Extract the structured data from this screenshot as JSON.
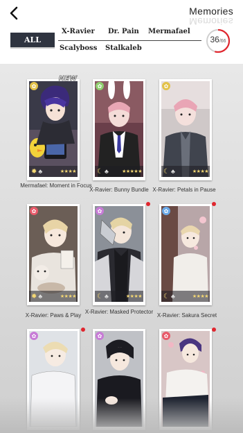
{
  "header": {
    "title": "Memories",
    "all_tab": "ALL",
    "filters": [
      "X-Ravier",
      "Dr. Pain",
      "Mermafael",
      "Scalyboss",
      "Stalkaleb"
    ],
    "count_current": "36",
    "count_total": "/66"
  },
  "cards": [
    {
      "caption": "Mermafael: Moment in Focus",
      "badge_color": "#e3c24a",
      "stars": "★★★★",
      "is_new": true,
      "new_label": "NEW",
      "has_dot": false
    },
    {
      "caption": "X-Ravier: Bunny Bundle",
      "badge_color": "#8fcf6f",
      "stars": "★★★★★",
      "is_new": false,
      "has_dot": false
    },
    {
      "caption": "X-Ravier: Petals in Pause",
      "badge_color": "#e3c24a",
      "stars": "★★★★",
      "is_new": false,
      "has_dot": false
    },
    {
      "caption": "X-Ravier: Paws & Play",
      "badge_color": "#e85a6a",
      "stars": "★★★★",
      "is_new": false,
      "has_dot": false
    },
    {
      "caption": "X-Ravier: Masked Protector",
      "badge_color": "#c77bd6",
      "stars": "★★★★",
      "is_new": false,
      "has_dot": true
    },
    {
      "caption": "X-Ravier: Sakura Secret",
      "badge_color": "#6aa9e8",
      "stars": "★★★★",
      "is_new": false,
      "has_dot": true
    },
    {
      "caption": "",
      "badge_color": "#c77bd6",
      "stars": "",
      "is_new": false,
      "has_dot": true
    },
    {
      "caption": "",
      "badge_color": "#c77bd6",
      "stars": "",
      "is_new": false,
      "has_dot": false
    },
    {
      "caption": "",
      "badge_color": "#e85a6a",
      "stars": "",
      "is_new": false,
      "has_dot": true
    }
  ],
  "colors": {
    "tab_bg": "#2f3440",
    "counter_ring": "#e0262e",
    "notification_dot": "#e0262e"
  },
  "icons": {
    "back": "chevron-left-icon",
    "mood": "crescent-moon-icon",
    "suit": "club-icon"
  }
}
